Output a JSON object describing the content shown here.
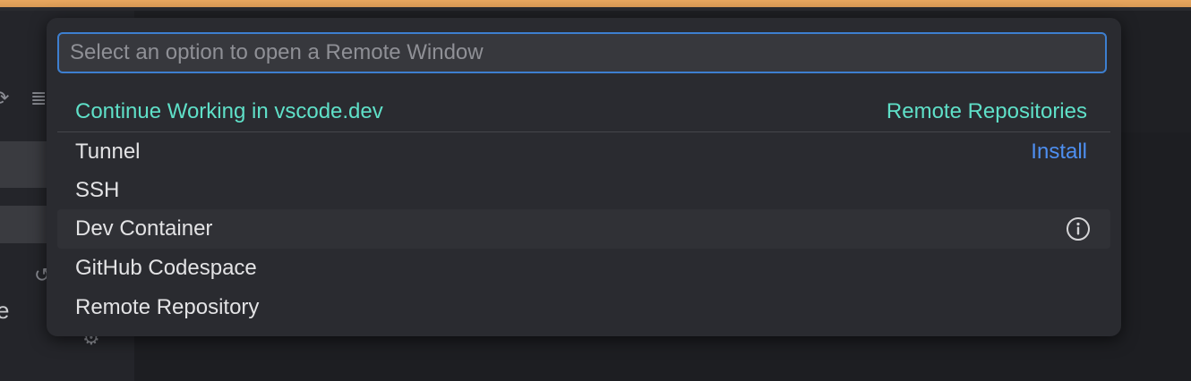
{
  "quickpick": {
    "placeholder": "Select an option to open a Remote Window",
    "value": "",
    "items": [
      {
        "label": "Continue Working in vscode.dev",
        "detail": "Remote Repositories"
      },
      {
        "label": "Tunnel",
        "action": "Install"
      },
      {
        "label": "SSH"
      },
      {
        "label": "Dev Container",
        "icon": "info-icon"
      },
      {
        "label": "GitHub Codespace"
      },
      {
        "label": "Remote Repository"
      }
    ]
  },
  "background": {
    "partial_text": "e"
  },
  "colors": {
    "accent": "#3d7fd0",
    "teal": "#5fe0c8",
    "link": "#4e8ff0",
    "panel": "#2a2b30"
  }
}
